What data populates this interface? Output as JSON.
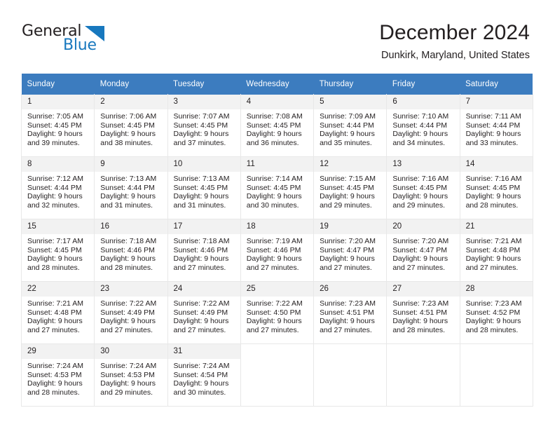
{
  "brand": {
    "name_part1": "General",
    "name_part2": "Blue",
    "triangle_color": "#1878be"
  },
  "header": {
    "title": "December 2024",
    "location": "Dunkirk, Maryland, United States",
    "accent_color": "#3c7cbf",
    "daynum_band_color": "#f2f2f2"
  },
  "weekday_headers": [
    "Sunday",
    "Monday",
    "Tuesday",
    "Wednesday",
    "Thursday",
    "Friday",
    "Saturday"
  ],
  "weeks": [
    [
      {
        "day": "1",
        "sunrise": "Sunrise: 7:05 AM",
        "sunset": "Sunset: 4:45 PM",
        "daylight1": "Daylight: 9 hours",
        "daylight2": "and 39 minutes."
      },
      {
        "day": "2",
        "sunrise": "Sunrise: 7:06 AM",
        "sunset": "Sunset: 4:45 PM",
        "daylight1": "Daylight: 9 hours",
        "daylight2": "and 38 minutes."
      },
      {
        "day": "3",
        "sunrise": "Sunrise: 7:07 AM",
        "sunset": "Sunset: 4:45 PM",
        "daylight1": "Daylight: 9 hours",
        "daylight2": "and 37 minutes."
      },
      {
        "day": "4",
        "sunrise": "Sunrise: 7:08 AM",
        "sunset": "Sunset: 4:45 PM",
        "daylight1": "Daylight: 9 hours",
        "daylight2": "and 36 minutes."
      },
      {
        "day": "5",
        "sunrise": "Sunrise: 7:09 AM",
        "sunset": "Sunset: 4:44 PM",
        "daylight1": "Daylight: 9 hours",
        "daylight2": "and 35 minutes."
      },
      {
        "day": "6",
        "sunrise": "Sunrise: 7:10 AM",
        "sunset": "Sunset: 4:44 PM",
        "daylight1": "Daylight: 9 hours",
        "daylight2": "and 34 minutes."
      },
      {
        "day": "7",
        "sunrise": "Sunrise: 7:11 AM",
        "sunset": "Sunset: 4:44 PM",
        "daylight1": "Daylight: 9 hours",
        "daylight2": "and 33 minutes."
      }
    ],
    [
      {
        "day": "8",
        "sunrise": "Sunrise: 7:12 AM",
        "sunset": "Sunset: 4:44 PM",
        "daylight1": "Daylight: 9 hours",
        "daylight2": "and 32 minutes."
      },
      {
        "day": "9",
        "sunrise": "Sunrise: 7:13 AM",
        "sunset": "Sunset: 4:44 PM",
        "daylight1": "Daylight: 9 hours",
        "daylight2": "and 31 minutes."
      },
      {
        "day": "10",
        "sunrise": "Sunrise: 7:13 AM",
        "sunset": "Sunset: 4:45 PM",
        "daylight1": "Daylight: 9 hours",
        "daylight2": "and 31 minutes."
      },
      {
        "day": "11",
        "sunrise": "Sunrise: 7:14 AM",
        "sunset": "Sunset: 4:45 PM",
        "daylight1": "Daylight: 9 hours",
        "daylight2": "and 30 minutes."
      },
      {
        "day": "12",
        "sunrise": "Sunrise: 7:15 AM",
        "sunset": "Sunset: 4:45 PM",
        "daylight1": "Daylight: 9 hours",
        "daylight2": "and 29 minutes."
      },
      {
        "day": "13",
        "sunrise": "Sunrise: 7:16 AM",
        "sunset": "Sunset: 4:45 PM",
        "daylight1": "Daylight: 9 hours",
        "daylight2": "and 29 minutes."
      },
      {
        "day": "14",
        "sunrise": "Sunrise: 7:16 AM",
        "sunset": "Sunset: 4:45 PM",
        "daylight1": "Daylight: 9 hours",
        "daylight2": "and 28 minutes."
      }
    ],
    [
      {
        "day": "15",
        "sunrise": "Sunrise: 7:17 AM",
        "sunset": "Sunset: 4:45 PM",
        "daylight1": "Daylight: 9 hours",
        "daylight2": "and 28 minutes."
      },
      {
        "day": "16",
        "sunrise": "Sunrise: 7:18 AM",
        "sunset": "Sunset: 4:46 PM",
        "daylight1": "Daylight: 9 hours",
        "daylight2": "and 28 minutes."
      },
      {
        "day": "17",
        "sunrise": "Sunrise: 7:18 AM",
        "sunset": "Sunset: 4:46 PM",
        "daylight1": "Daylight: 9 hours",
        "daylight2": "and 27 minutes."
      },
      {
        "day": "18",
        "sunrise": "Sunrise: 7:19 AM",
        "sunset": "Sunset: 4:46 PM",
        "daylight1": "Daylight: 9 hours",
        "daylight2": "and 27 minutes."
      },
      {
        "day": "19",
        "sunrise": "Sunrise: 7:20 AM",
        "sunset": "Sunset: 4:47 PM",
        "daylight1": "Daylight: 9 hours",
        "daylight2": "and 27 minutes."
      },
      {
        "day": "20",
        "sunrise": "Sunrise: 7:20 AM",
        "sunset": "Sunset: 4:47 PM",
        "daylight1": "Daylight: 9 hours",
        "daylight2": "and 27 minutes."
      },
      {
        "day": "21",
        "sunrise": "Sunrise: 7:21 AM",
        "sunset": "Sunset: 4:48 PM",
        "daylight1": "Daylight: 9 hours",
        "daylight2": "and 27 minutes."
      }
    ],
    [
      {
        "day": "22",
        "sunrise": "Sunrise: 7:21 AM",
        "sunset": "Sunset: 4:48 PM",
        "daylight1": "Daylight: 9 hours",
        "daylight2": "and 27 minutes."
      },
      {
        "day": "23",
        "sunrise": "Sunrise: 7:22 AM",
        "sunset": "Sunset: 4:49 PM",
        "daylight1": "Daylight: 9 hours",
        "daylight2": "and 27 minutes."
      },
      {
        "day": "24",
        "sunrise": "Sunrise: 7:22 AM",
        "sunset": "Sunset: 4:49 PM",
        "daylight1": "Daylight: 9 hours",
        "daylight2": "and 27 minutes."
      },
      {
        "day": "25",
        "sunrise": "Sunrise: 7:22 AM",
        "sunset": "Sunset: 4:50 PM",
        "daylight1": "Daylight: 9 hours",
        "daylight2": "and 27 minutes."
      },
      {
        "day": "26",
        "sunrise": "Sunrise: 7:23 AM",
        "sunset": "Sunset: 4:51 PM",
        "daylight1": "Daylight: 9 hours",
        "daylight2": "and 27 minutes."
      },
      {
        "day": "27",
        "sunrise": "Sunrise: 7:23 AM",
        "sunset": "Sunset: 4:51 PM",
        "daylight1": "Daylight: 9 hours",
        "daylight2": "and 28 minutes."
      },
      {
        "day": "28",
        "sunrise": "Sunrise: 7:23 AM",
        "sunset": "Sunset: 4:52 PM",
        "daylight1": "Daylight: 9 hours",
        "daylight2": "and 28 minutes."
      }
    ],
    [
      {
        "day": "29",
        "sunrise": "Sunrise: 7:24 AM",
        "sunset": "Sunset: 4:53 PM",
        "daylight1": "Daylight: 9 hours",
        "daylight2": "and 28 minutes."
      },
      {
        "day": "30",
        "sunrise": "Sunrise: 7:24 AM",
        "sunset": "Sunset: 4:53 PM",
        "daylight1": "Daylight: 9 hours",
        "daylight2": "and 29 minutes."
      },
      {
        "day": "31",
        "sunrise": "Sunrise: 7:24 AM",
        "sunset": "Sunset: 4:54 PM",
        "daylight1": "Daylight: 9 hours",
        "daylight2": "and 30 minutes."
      },
      {
        "day": "",
        "sunrise": "",
        "sunset": "",
        "daylight1": "",
        "daylight2": ""
      },
      {
        "day": "",
        "sunrise": "",
        "sunset": "",
        "daylight1": "",
        "daylight2": ""
      },
      {
        "day": "",
        "sunrise": "",
        "sunset": "",
        "daylight1": "",
        "daylight2": ""
      },
      {
        "day": "",
        "sunrise": "",
        "sunset": "",
        "daylight1": "",
        "daylight2": ""
      }
    ]
  ]
}
